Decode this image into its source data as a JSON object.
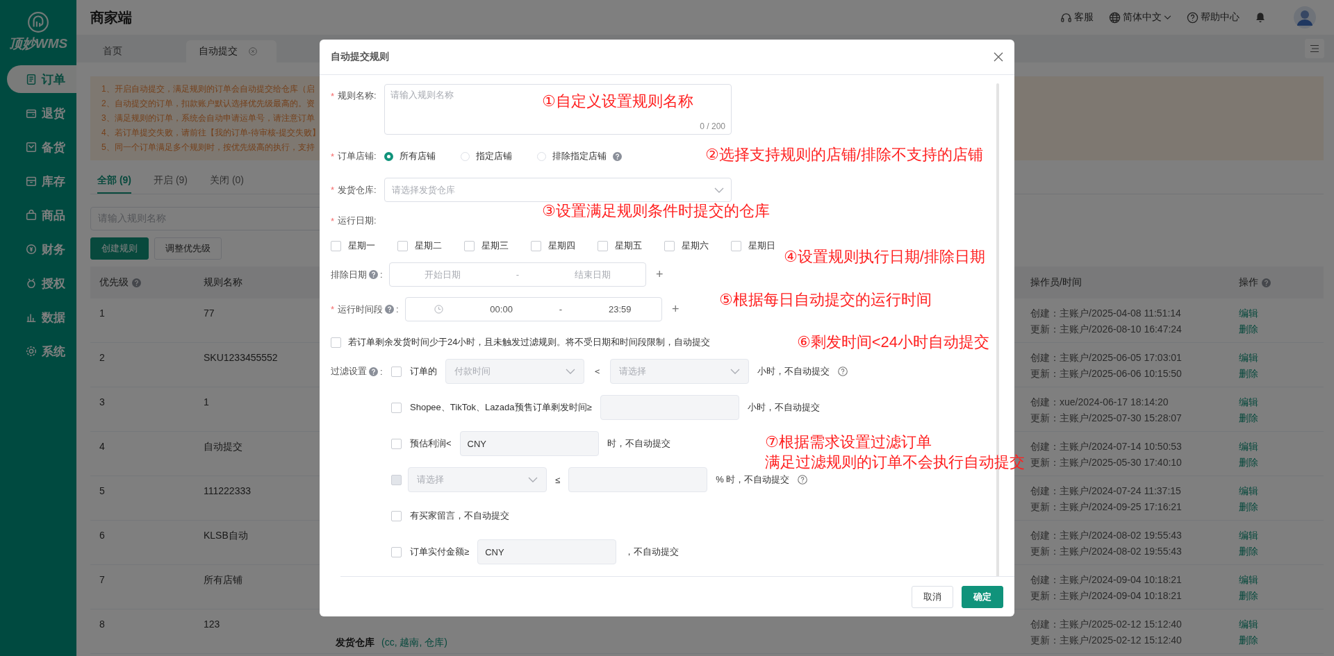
{
  "sidebar": {
    "logo_text": "顶妙WMS",
    "items": [
      {
        "label": "订单",
        "selected": true
      },
      {
        "label": "退货",
        "selected": false
      },
      {
        "label": "备货",
        "selected": false
      },
      {
        "label": "库存",
        "selected": false
      },
      {
        "label": "商品",
        "selected": false
      },
      {
        "label": "财务",
        "selected": false
      },
      {
        "label": "授权",
        "selected": false
      },
      {
        "label": "数据",
        "selected": false
      },
      {
        "label": "系统",
        "selected": false
      }
    ]
  },
  "header": {
    "title": "商家端",
    "links": [
      {
        "kind": "support",
        "label": "客服",
        "dropdown": false
      },
      {
        "kind": "language",
        "label": "简体中文",
        "dropdown": true
      },
      {
        "kind": "help",
        "label": "帮助中心",
        "dropdown": false
      }
    ]
  },
  "page_tabs": [
    {
      "label": "首页",
      "selected": false,
      "closable": false
    },
    {
      "label": "自动提交",
      "selected": true,
      "closable": true
    }
  ],
  "notice": [
    "1、开启自动提交，满足规则的订单会自动提交给仓库（启",
    "2、自动提交的订单，扣款账户默认选择优先级最高的。资",
    "3、满足规则的订单，系统会自动申请运单号，请注意订单",
    "4、若订单提交失败，请前往【我的订单-待审核-提交失败】",
    "5、同一个订单满足多个规则时，按优先级高的执行，支持"
  ],
  "filter_tabs": [
    {
      "label": "全部 (9)",
      "selected": true
    },
    {
      "label": "开启 (9)",
      "selected": false
    },
    {
      "label": "关闭 (0)",
      "selected": false
    }
  ],
  "search": {
    "placeholder": "请输入规则名称"
  },
  "buttons": [
    {
      "label": "创建规则",
      "kind": "primary"
    },
    {
      "label": "调整优先级",
      "kind": "default"
    }
  ],
  "table": {
    "columns": [
      {
        "label": "优先级",
        "help": true
      },
      {
        "label": "规则名称",
        "help": false
      },
      {
        "label": "操作员/时间",
        "help": false
      },
      {
        "label": "操作",
        "help": true
      }
    ],
    "rows": [
      {
        "priority": "1",
        "name": "77",
        "created": "创建：主账户/2025-04-08 11:51:14",
        "updated": "更新：主账户/2026-08-10 16:47:24",
        "actions": [
          "编辑",
          "删除"
        ]
      },
      {
        "priority": "2",
        "name": "SKU1233455552",
        "created": "创建：主账户/2025-06-05 17:03:01",
        "updated": "更新：主账户/2025-06-06 10:15:50",
        "actions": [
          "编辑",
          "删除"
        ]
      },
      {
        "priority": "3",
        "name": "1",
        "created": "创建：xue/2024-06-17 18:14:20",
        "updated": "更新：主账户/2025-07-30 15:28:07",
        "actions": [
          "编辑",
          "删除"
        ]
      },
      {
        "priority": "4",
        "name": "自动提交",
        "created": "创建：主账户/2024-07-14 10:50:53",
        "updated": "更新：主账户/2025-05-30 17:40:10",
        "actions": [
          "编辑",
          "删除"
        ]
      },
      {
        "priority": "5",
        "name": "111222333",
        "created": "创建：主账户/2024-07-24 11:37:15",
        "updated": "更新：主账户/2024-09-25 17:16:21",
        "actions": [
          "编辑",
          "删除"
        ]
      },
      {
        "priority": "6",
        "name": "KLSB自动",
        "created": "创建：主账户/2024-08-02 19:55:43",
        "updated": "更新：主账户/2024-08-02 19:55:43",
        "actions": [
          "编辑",
          "删除"
        ]
      },
      {
        "priority": "7",
        "name": "所有店铺",
        "created": "创建：主账户/2024-09-04 10:18:21",
        "updated": "更新：主账户/2024-09-04 10:18:21",
        "actions": [
          "编辑",
          "删除"
        ]
      },
      {
        "priority": "8",
        "name": "123",
        "rule": {
          "label": "发货仓库",
          "value": "(cc, 越南, 仓库)"
        },
        "created": "创建：主账户/2025-02-12 15:12:40",
        "updated": "更新：主账户/2025-02-12 15:12:40",
        "actions": [
          "编辑",
          "删除"
        ]
      }
    ]
  },
  "modal": {
    "title": "自动提交规则",
    "required_mark": "*",
    "name_field": {
      "label": "规则名称:",
      "required": true,
      "help": false,
      "placeholder": "请输入规则名称",
      "counter": "0 / 200"
    },
    "shop": {
      "label": "订单店铺:",
      "required": true,
      "help": false,
      "options": [
        {
          "label": "所有店铺",
          "selected": true,
          "help": false
        },
        {
          "label": "指定店铺",
          "selected": false,
          "help": false
        },
        {
          "label": "排除指定店铺",
          "selected": false,
          "help": true
        }
      ]
    },
    "warehouse": {
      "label": "发货仓库:",
      "required": true,
      "help": false,
      "placeholder": "请选择发货仓库"
    },
    "run_days": {
      "label": "运行日期:",
      "required": true,
      "help": false,
      "days": [
        {
          "label": "星期一",
          "checked": false
        },
        {
          "label": "星期二",
          "checked": false
        },
        {
          "label": "星期三",
          "checked": false
        },
        {
          "label": "星期四",
          "checked": false
        },
        {
          "label": "星期五",
          "checked": false
        },
        {
          "label": "星期六",
          "checked": false
        },
        {
          "label": "星期日",
          "checked": false
        }
      ]
    },
    "exclude_dates": {
      "label": "排除日期",
      "required": false,
      "help": true,
      "suffix": ":",
      "start_placeholder": "开始日期",
      "separator": "-",
      "end_placeholder": "结束日期",
      "add": "+"
    },
    "run_time": {
      "label": "运行时间段",
      "required": true,
      "help": true,
      "suffix": ":",
      "start": "00:00",
      "separator": "-",
      "end": "23:59",
      "add": "+"
    },
    "urgent": {
      "label": "若订单剩余发货时间少于24小时，且未触发过滤规则。将不受日期和时间段限制，自动提交",
      "checked": false
    },
    "filters": {
      "label": "过滤设置",
      "required": false,
      "help": true,
      "suffix": ":",
      "rows": [
        {
          "checked": false,
          "disabled": false,
          "parts": [
            {
              "kind": "text",
              "text": "订单的"
            },
            {
              "kind": "select",
              "placeholder": "付款时间"
            },
            {
              "kind": "text",
              "text": "＜"
            },
            {
              "kind": "select",
              "placeholder": "请选择"
            },
            {
              "kind": "text",
              "text": "小时，不自动提交"
            },
            {
              "kind": "help"
            }
          ]
        },
        {
          "checked": false,
          "disabled": false,
          "parts": [
            {
              "kind": "text",
              "text": "Shopee、TikTok、Lazada预售订单剩发时间≥"
            },
            {
              "kind": "input"
            },
            {
              "kind": "text",
              "text": "小时，不自动提交"
            }
          ]
        },
        {
          "checked": false,
          "disabled": false,
          "parts": [
            {
              "kind": "text",
              "text": "预估利润<"
            },
            {
              "kind": "input",
              "prefix": "CNY"
            },
            {
              "kind": "text",
              "text": "时，不自动提交"
            }
          ]
        },
        {
          "checked": false,
          "disabled": true,
          "parts": [
            {
              "kind": "select",
              "placeholder": "请选择"
            },
            {
              "kind": "text",
              "text": "≤"
            },
            {
              "kind": "input"
            },
            {
              "kind": "text",
              "text": "% 时，不自动提交"
            },
            {
              "kind": "help"
            }
          ]
        },
        {
          "checked": false,
          "disabled": false,
          "parts": [
            {
              "kind": "text",
              "text": "有买家留言，不自动提交"
            }
          ]
        },
        {
          "checked": false,
          "disabled": false,
          "parts": [
            {
              "kind": "text",
              "text": "订单实付金额≥"
            },
            {
              "kind": "input",
              "prefix": "CNY"
            },
            {
              "kind": "text",
              "text": "，不自动提交"
            }
          ]
        }
      ]
    },
    "buttons": [
      {
        "label": "取消",
        "kind": "default"
      },
      {
        "label": "确定",
        "kind": "primary"
      }
    ]
  },
  "annotations": [
    {
      "lines": [
        "①自定义设置规则名称"
      ]
    },
    {
      "lines": [
        "②选择支持规则的店铺/排除不支持的店铺"
      ]
    },
    {
      "lines": [
        "③设置满足规则条件时提交的仓库"
      ]
    },
    {
      "lines": [
        "④设置规则执行日期/排除日期"
      ]
    },
    {
      "lines": [
        "⑤根据每日自动提交的运行时间"
      ]
    },
    {
      "lines": [
        "⑥剩发时间<24小时自动提交"
      ]
    },
    {
      "lines": [
        "⑦根据需求设置过滤订单",
        "满足过滤规则的订单不会执行自动提交"
      ]
    }
  ]
}
